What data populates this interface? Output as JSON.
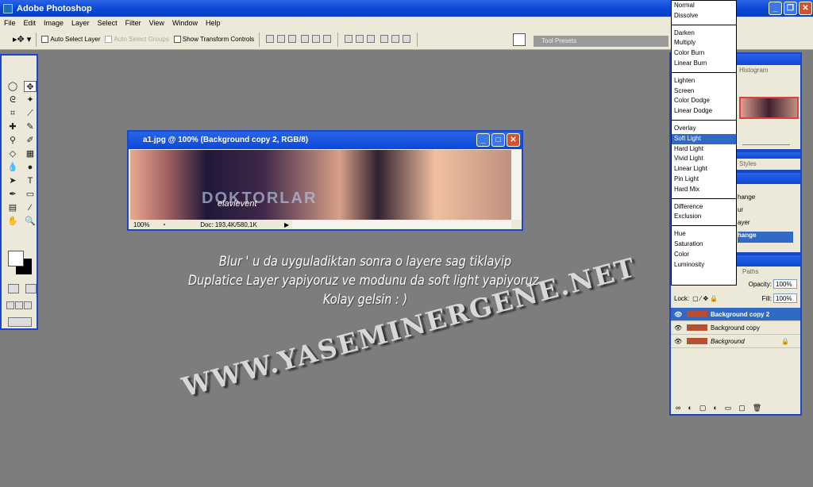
{
  "app": {
    "title": "Adobe Photoshop"
  },
  "menu": [
    "File",
    "Edit",
    "Image",
    "Layer",
    "Select",
    "Filter",
    "View",
    "Window",
    "Help"
  ],
  "options": {
    "auto_select_layer": "Auto Select Layer",
    "auto_select_groups": "Auto Select Groups",
    "show_transform": "Show Transform Controls",
    "tool_presets": "Tool Presets"
  },
  "document": {
    "title": "a1.jpg @ 100% (Background copy 2, RGB/8)",
    "zoom": "100%",
    "doc_size": "Doc: 193,4K/580,1K",
    "watermark": "DOKTORLAR",
    "signature": "elavlevent"
  },
  "blend_modes": {
    "groups": [
      [
        "Normal",
        "Dissolve"
      ],
      [
        "Darken",
        "Multiply",
        "Color Burn",
        "Linear Burn"
      ],
      [
        "Lighten",
        "Screen",
        "Color Dodge",
        "Linear Dodge"
      ],
      [
        "Overlay",
        "Soft Light",
        "Hard Light",
        "Vivid Light",
        "Linear Light",
        "Pin Light",
        "Hard Mix"
      ],
      [
        "Difference",
        "Exclusion"
      ],
      [
        "Hue",
        "Saturation",
        "Color",
        "Luminosity"
      ]
    ],
    "selected": "Soft Light"
  },
  "panels": {
    "histogram_tab": "Histogram",
    "styles_tab": "Styles",
    "history_items": [
      "hange",
      "ur",
      "ayer",
      "hange"
    ],
    "paths_tab": "Paths"
  },
  "layers": {
    "opacity_label": "Opacity:",
    "opacity": "100%",
    "lock_label": "Lock:",
    "fill_label": "Fill:",
    "fill": "100%",
    "items": [
      "Background copy 2",
      "Background copy",
      "Background"
    ],
    "selected": "Background copy 2"
  },
  "caption": [
    "Blur ' u da uyguladiktan sonra o layere sag tiklayip",
    "Duplatice Layer yapiyoruz ve modunu da soft light yapiyoruz.",
    "Kolay gelsin   : )"
  ],
  "watermark": "WWW.YASEMINERGENE.NET"
}
